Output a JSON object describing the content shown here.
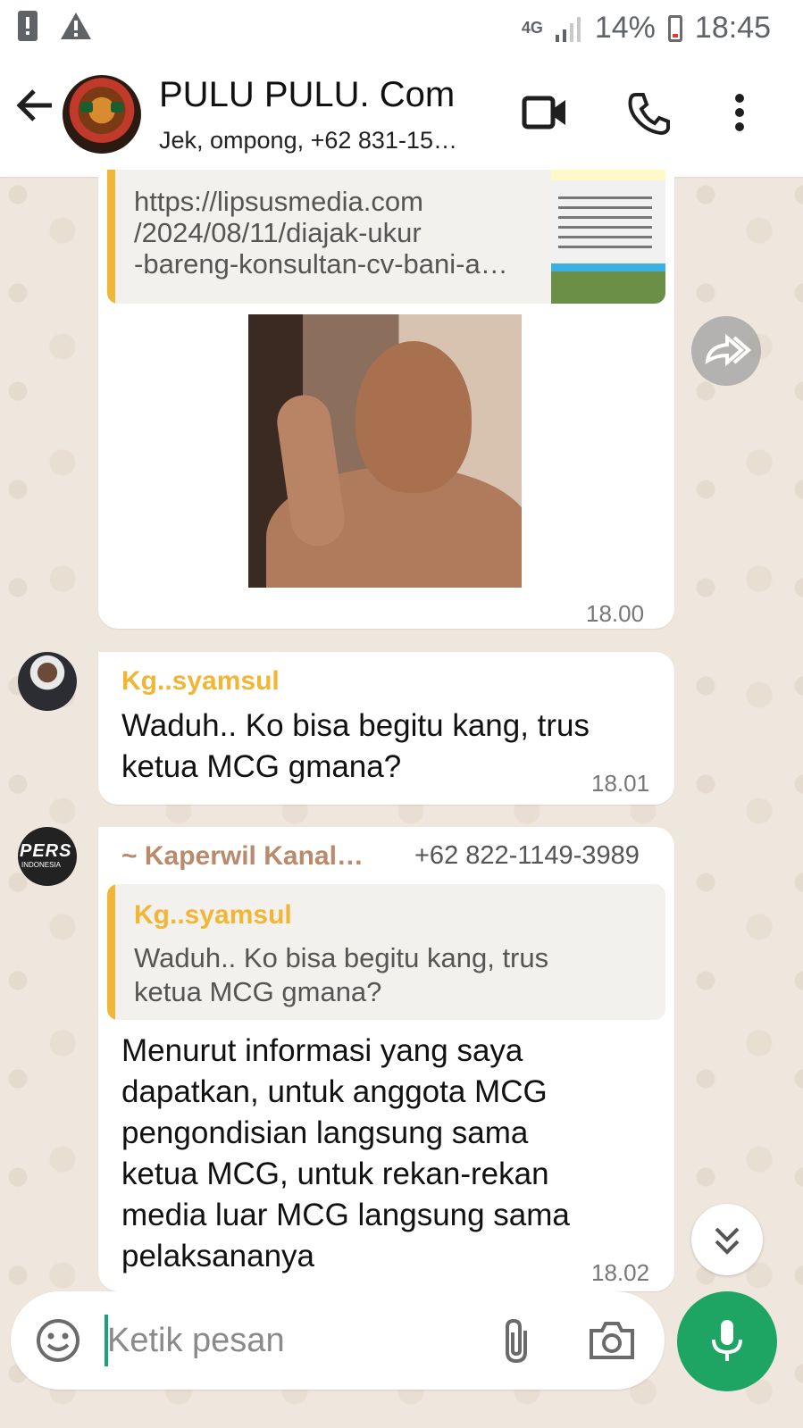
{
  "status_bar": {
    "network": "4G",
    "battery_percent": "14%",
    "time": "18:45",
    "left_icons": [
      "notification-alert-icon",
      "warning-icon"
    ]
  },
  "header": {
    "title": "PULU PULU. Com",
    "subtitle": "Jek, ompong, +62 831-15…"
  },
  "messages": [
    {
      "link_preview_lines": [
        "https://lipsusmedia.com",
        "/2024/08/11/diajak-ukur",
        "-bareng-konsultan-cv-bani-a…"
      ],
      "has_photo": true,
      "time": "18.00"
    },
    {
      "sender": "Kg..syamsul",
      "sender_color": "#f2b637",
      "lines": [
        "Waduh.. Ko bisa begitu kang, trus",
        "ketua MCG gmana?"
      ],
      "time": "18.01"
    },
    {
      "sender": "~ Kaperwil Kanal…",
      "sender_color": "#b98a6b",
      "sender_phone": "+62 822-1149-3989",
      "quote_sender": "Kg..syamsul",
      "quote_lines": [
        "Waduh.. Ko bisa begitu kang, trus",
        "ketua MCG gmana?"
      ],
      "lines": [
        "Menurut informasi yang saya",
        "dapatkan, untuk anggota MCG",
        "pengondisian langsung sama",
        "ketua MCG, untuk rekan-rekan",
        "media luar MCG langsung sama",
        "pelaksananya"
      ],
      "time": "18.02"
    }
  ],
  "avatar2_text": "PERS",
  "avatar2_subtext": "INDONESIA",
  "input": {
    "placeholder": "Ketik pesan"
  },
  "colors": {
    "accent_green": "#1ea563",
    "quote_bar": "#f2b637"
  }
}
